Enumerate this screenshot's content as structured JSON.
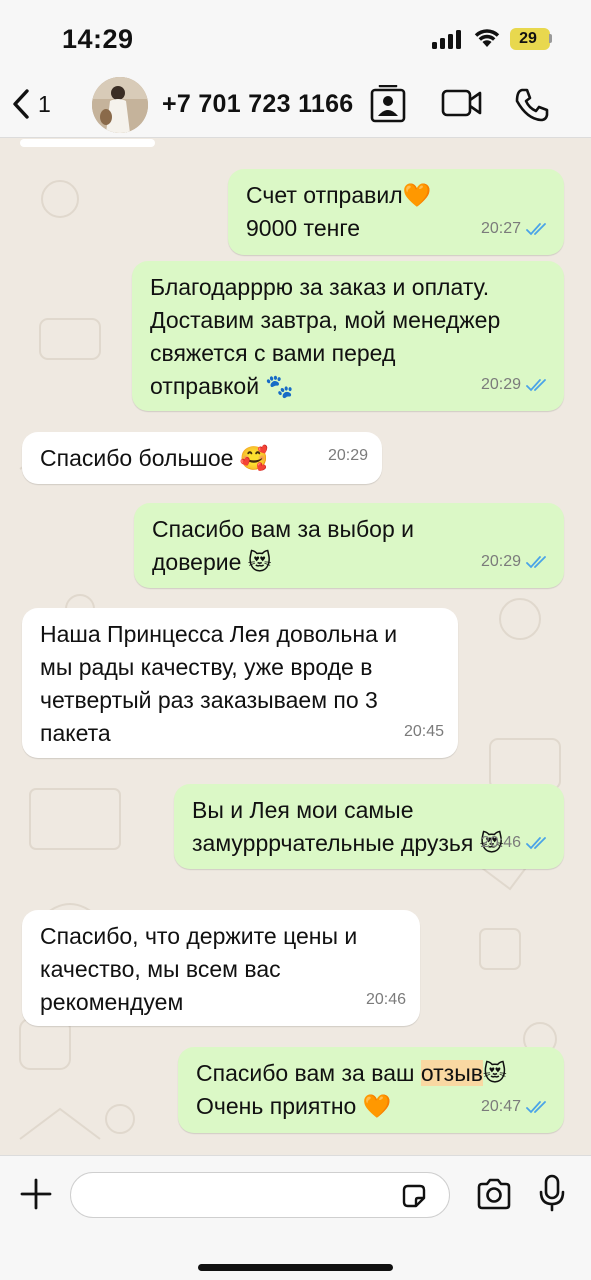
{
  "status_bar": {
    "time": "14:29",
    "battery": "29"
  },
  "header": {
    "back_count": "1",
    "contact": "+7 701 723 1166",
    "icons": [
      "chevron-left-icon",
      "contact-card-icon",
      "video-call-icon",
      "phone-icon"
    ]
  },
  "messages": [
    {
      "dir": "out",
      "text": "Счет отправил🧡\n9000 тенге",
      "time": "20:27",
      "read": true
    },
    {
      "dir": "out",
      "text": "Благодарррю за заказ и оплату.\nДоставим завтра, мой менеджер\nсвяжется с вами перед\nотправкой 🐾",
      "time": "20:29",
      "read": true
    },
    {
      "dir": "in",
      "text": "Спасибо большое 🥰",
      "time": "20:29"
    },
    {
      "dir": "out",
      "text": "Спасибо вам за выбор и\nдоверие 😻",
      "time": "20:29",
      "read": true
    },
    {
      "dir": "in",
      "text": "Наша Принцесса Лея довольна и\nмы рады качеству, уже вроде в\nчетвертый раз заказываем по 3\nпакета",
      "time": "20:45"
    },
    {
      "dir": "out",
      "text": "Вы и Лея мои самые\nзамурррчательные друзья 😻",
      "time": "20:46",
      "read": true
    },
    {
      "dir": "in",
      "text": "Спасибо, что держите цены и\nкачество, мы всем вас\nрекомендуем",
      "time": "20:46"
    },
    {
      "dir": "out",
      "text_before": "Спасибо вам за ваш ",
      "highlight": "отзыв",
      "text_after": "😻\nОчень приятно 🧡",
      "time": "20:47",
      "read": true
    }
  ],
  "composer": {
    "placeholder": ""
  },
  "colors": {
    "outgoing_bubble": "#dbf8c6",
    "incoming_bubble": "#ffffff",
    "read_ticks": "#4aa3e8",
    "highlight": "#f9d8a2",
    "wallpaper": "#efe9e1"
  }
}
